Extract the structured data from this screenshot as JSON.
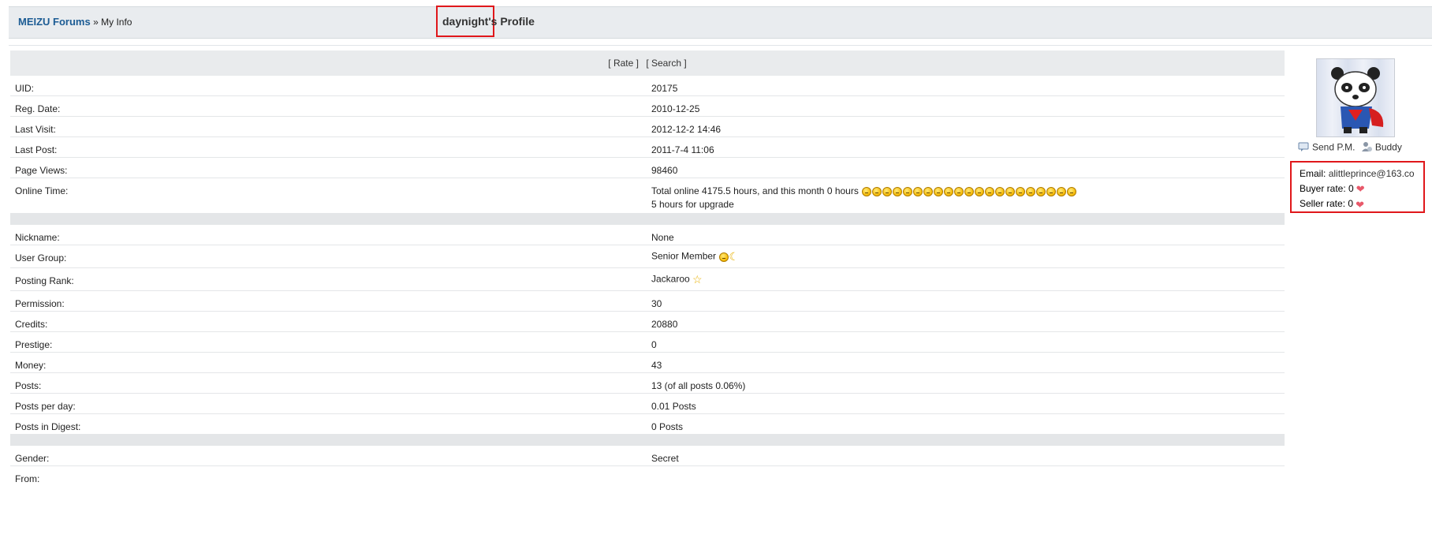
{
  "breadcrumb": {
    "forum": "MEIZU Forums",
    "separator": "»",
    "current": "My Info"
  },
  "page_title": "daynight's Profile",
  "actions": {
    "rate": "[ Rate ]",
    "search": "[ Search ]"
  },
  "sections": [
    {
      "rows": [
        {
          "label": "UID:",
          "value": "20175"
        },
        {
          "label": "Reg. Date:",
          "value": "2010-12-25"
        },
        {
          "label": "Last Visit:",
          "value": "2012-12-2 14:46"
        },
        {
          "label": "Last Post:",
          "value": "2011-7-4 11:06"
        },
        {
          "label": "Page Views:",
          "value": "98460"
        },
        {
          "label": "Online Time:",
          "value": "Total online 4175.5 hours, and this month 0 hours",
          "value2": "5 hours for upgrade",
          "icon": "smiley-icon",
          "icon_count": 21
        }
      ]
    },
    {
      "rows": [
        {
          "label": "Nickname:",
          "value": "None"
        },
        {
          "label": "User Group:",
          "value": "Senior Member",
          "icons": [
            "smiley-icon",
            "moon-icon"
          ]
        },
        {
          "label": "Posting Rank:",
          "value": "Jackaroo",
          "icons": [
            "star-icon"
          ]
        },
        {
          "label": "Permission:",
          "value": "30"
        },
        {
          "label": "Credits:",
          "value": "20880"
        },
        {
          "label": "Prestige:",
          "value": "0"
        },
        {
          "label": "Money:",
          "value": "43"
        },
        {
          "label": "Posts:",
          "value": "13 (of all posts 0.06%)"
        },
        {
          "label": "Posts per day:",
          "value": "0.01 Posts"
        },
        {
          "label": "Posts in Digest:",
          "value": "0 Posts"
        }
      ]
    },
    {
      "rows": [
        {
          "label": "Gender:",
          "value": "Secret"
        },
        {
          "label": "From:",
          "value": ""
        }
      ]
    }
  ],
  "sidebar": {
    "avatar_icon": "panda-avatar-icon",
    "send_pm": "Send P.M.",
    "buddy": "Buddy",
    "email_label": "Email:",
    "email": "alittleprince@163.co",
    "buyer_label": "Buyer rate:",
    "buyer_value": "0",
    "seller_label": "Seller rate:",
    "seller_value": "0"
  },
  "colors": {
    "link": "#1c5c94",
    "highlight": "#e0171b",
    "header_bg": "#e9ecef"
  }
}
